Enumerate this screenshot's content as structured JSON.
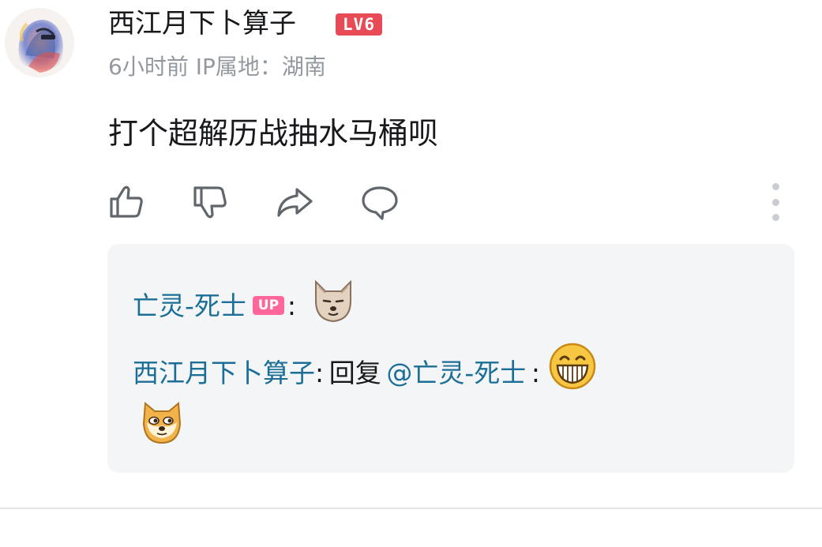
{
  "comment": {
    "username": "西江月下卜算子",
    "level_badge": "LV6",
    "meta": "6小时前 IP属地：湖南",
    "text": "打个超解历战抽水马桶呗",
    "icons": [
      "avatar-lion",
      "thumbs-up-icon",
      "thumbs-down-icon",
      "share-icon",
      "reply-icon",
      "more-vertical-icon"
    ]
  },
  "replies": {
    "reply1": {
      "author": "亡灵-死士",
      "author_badge": "UP",
      "colon": ":",
      "emoji": "wolf-emoji"
    },
    "reply2": {
      "author": "西江月下卜算子",
      "colon": ":",
      "reply_word": "回复",
      "mention": "@亡灵-死士",
      "colon2": ":",
      "emojis": [
        "grin-emoji",
        "doge-emoji"
      ]
    }
  },
  "colors": {
    "link": "#1b6f97",
    "level_badge": "#e84b55",
    "up_badge": "#ff6699",
    "meta": "#9499a0",
    "reply_bg": "#f4f5f7"
  }
}
